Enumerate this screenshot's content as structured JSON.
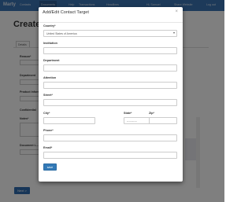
{
  "navbar": {
    "brand": "Marty",
    "items": [
      "Contacts",
      "Documents",
      "Help",
      "Transactions",
      "Headlines"
    ],
    "active_index": 1,
    "user": "Hi, Samuel",
    "share": "Share Website",
    "logout": "Log out"
  },
  "page": {
    "title": "Create F",
    "tab": "Details",
    "labels": [
      "Reason*",
      "Department",
      "Product Inform",
      "Confidential",
      "Notes*",
      "Document L..."
    ],
    "next_button": "Next >"
  },
  "modal": {
    "title": "Add/Edit Contact Target",
    "close_symbol": "×",
    "country_label": "Country*",
    "country_value": "United States of America",
    "institution_label": "Institution",
    "department_label": "Department",
    "attention_label": "Attention",
    "street_label": "Street*",
    "city_label": "City*",
    "state_label": "State*",
    "state_value": "-----------",
    "zip_label": "Zip*",
    "phone_label": "Phone*",
    "email_label": "Email*",
    "save_label": "save"
  }
}
